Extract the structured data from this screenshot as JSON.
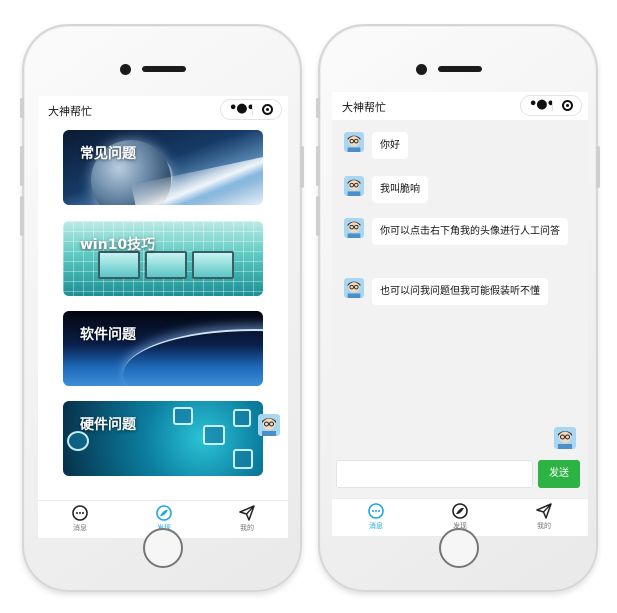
{
  "navbar": {
    "title": "大神帮忙"
  },
  "discover": {
    "banners": [
      {
        "label": "常见问题"
      },
      {
        "label": "win10技巧"
      },
      {
        "label": "软件问题"
      },
      {
        "label": "硬件问题"
      }
    ]
  },
  "chat": {
    "messages": [
      {
        "text": "你好"
      },
      {
        "text": "我叫脆响"
      },
      {
        "text": "你可以点击右下角我的头像进行人工问答"
      },
      {
        "text": "也可以问我问题但我可能假装听不懂"
      }
    ],
    "input": {
      "value": "",
      "placeholder": ""
    },
    "send_label": "发送"
  },
  "tabbar": {
    "items": [
      {
        "label": "消息",
        "icon": "message-dots-icon"
      },
      {
        "label": "发现",
        "icon": "compass-icon"
      },
      {
        "label": "我的",
        "icon": "paper-plane-icon"
      }
    ],
    "active_color": "#1ea7e1"
  },
  "colors": {
    "send_button": "#2db244",
    "chat_background": "#f2f2f2"
  }
}
